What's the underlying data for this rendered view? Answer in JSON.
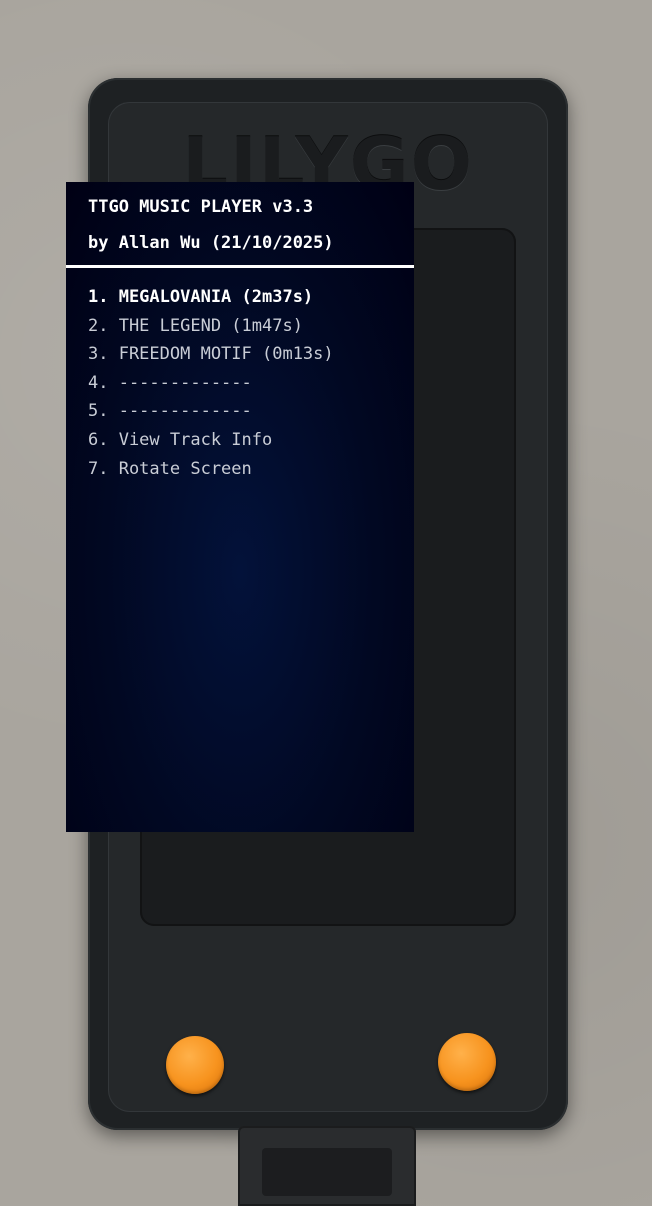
{
  "device": {
    "brand": "LILYGO"
  },
  "screen": {
    "title": "TTGO MUSIC PLAYER v3.3",
    "subtitle": "by Allan Wu (21/10/2025)",
    "menu": [
      {
        "label": "1. MEGALOVANIA (2m37s)",
        "selected": true
      },
      {
        "label": "2. THE LEGEND (1m47s)",
        "selected": false
      },
      {
        "label": "3. FREEDOM MOTIF (0m13s)",
        "selected": false
      },
      {
        "label": "4. -------------",
        "selected": false
      },
      {
        "label": "5. -------------",
        "selected": false
      },
      {
        "label": "6. View Track Info",
        "selected": false
      },
      {
        "label": "7. Rotate Screen",
        "selected": false
      }
    ]
  },
  "buttons": {
    "left_icon": "orange-round-button",
    "right_icon": "orange-round-button",
    "color": "#f7931e"
  },
  "colors": {
    "screen_background": "#000014",
    "selected_text": "#ffffff",
    "menu_text": "#c9cdd6",
    "device_body": "#1e2123"
  }
}
